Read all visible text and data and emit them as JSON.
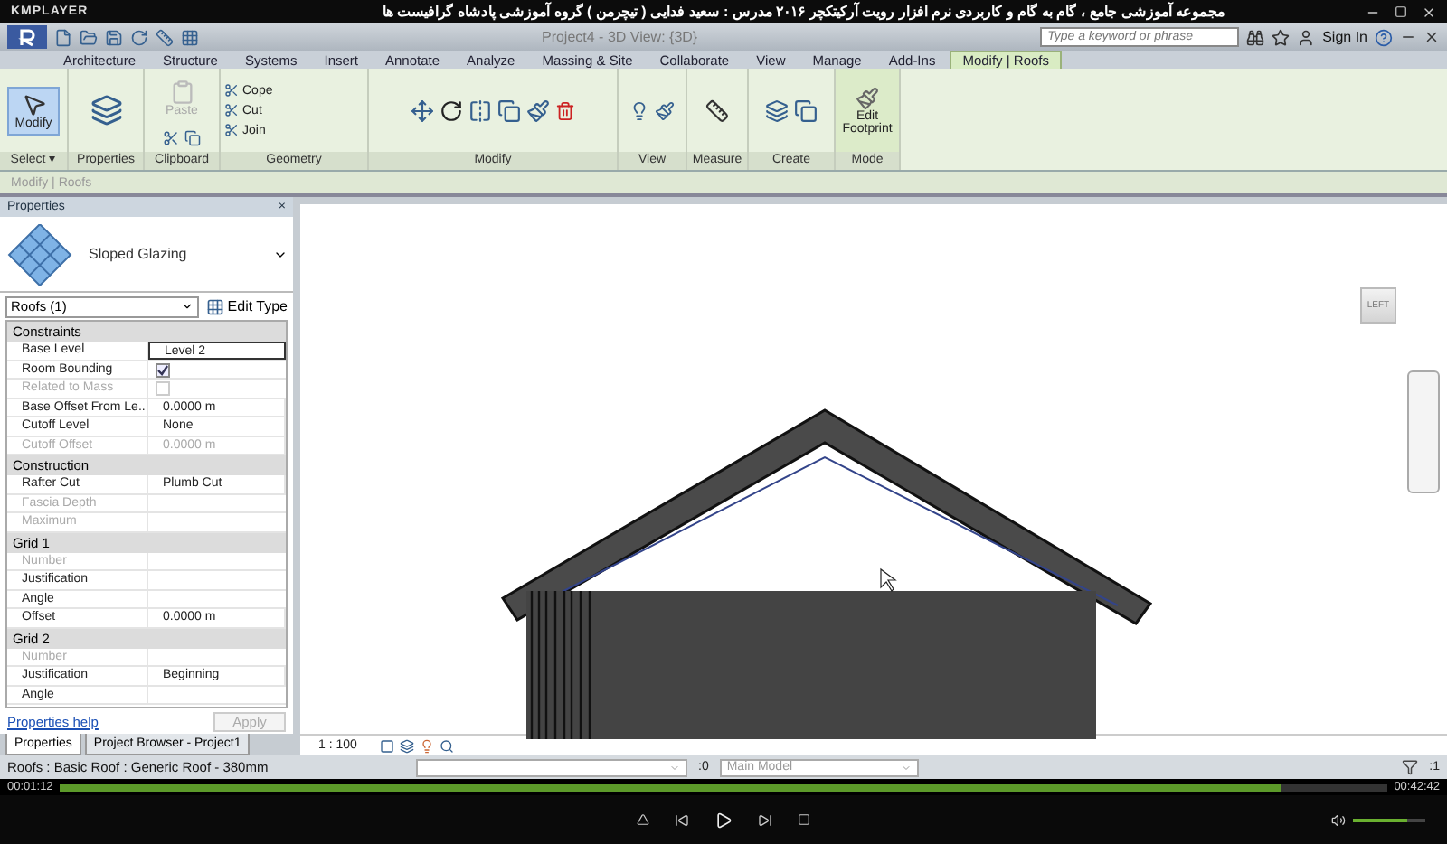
{
  "player": {
    "app_name": "KMPLAYER",
    "title": "مجموعه آموزشی جامع ، گام به گام و کاربردی نرم افزار رویت آرکیتکچر ۲۰۱۶  مدرس : سعید فدایی ( تیچرمن ) گروه آموزشی پادشاه گرافیست ها",
    "elapsed": "00:01:12",
    "total": "00:42:42",
    "level": 0.92,
    "volume": {
      "level": 0.75
    }
  },
  "app": {
    "view_title": "Project4 - 3D View: {3D}",
    "search": {
      "placeholder": "Type a keyword or phrase"
    },
    "sign_in": "Sign In"
  },
  "tabs": [
    {
      "label": "Architecture",
      "selected": false
    },
    {
      "label": "Structure",
      "selected": false
    },
    {
      "label": "Systems",
      "selected": false
    },
    {
      "label": "Insert",
      "selected": false
    },
    {
      "label": "Annotate",
      "selected": false
    },
    {
      "label": "Analyze",
      "selected": false
    },
    {
      "label": "Massing & Site",
      "selected": false
    },
    {
      "label": "Collaborate",
      "selected": false
    },
    {
      "label": "View",
      "selected": false
    },
    {
      "label": "Manage",
      "selected": false
    },
    {
      "label": "Add-Ins",
      "selected": false
    },
    {
      "label": "Modify | Roofs",
      "selected": true
    }
  ],
  "ribbon": {
    "modify": "Modify",
    "paste": "Paste",
    "geometry": [
      "Cope",
      "Cut",
      "Join"
    ],
    "edit_footprint": "Edit Footprint",
    "panels": [
      "Select ▾",
      "Properties",
      "Clipboard",
      "Geometry",
      "Modify",
      "View",
      "Measure",
      "Create",
      "Mode"
    ]
  },
  "context_bar": "Modify | Roofs",
  "properties": {
    "title": "Properties",
    "close": "×",
    "type_name": "Sloped Glazing",
    "selector": "Roofs (1)",
    "edit_type": "Edit Type",
    "groups": [
      {
        "name": "Constraints",
        "rows": [
          {
            "label": "Base Level",
            "kind": "text",
            "value": "Level 2",
            "disabled": false
          },
          {
            "label": "Room Bounding",
            "kind": "check",
            "checked": true,
            "disabled": false
          },
          {
            "label": "Related to Mass",
            "kind": "check",
            "checked": false,
            "disabled": true
          },
          {
            "label": "Base Offset From Le...",
            "kind": "text",
            "value": "0.0000 m",
            "disabled": false
          },
          {
            "label": "Cutoff Level",
            "kind": "text",
            "value": "None",
            "disabled": false
          },
          {
            "label": "Cutoff Offset",
            "kind": "text",
            "value": "0.0000 m",
            "disabled": true
          }
        ]
      },
      {
        "name": "Construction",
        "rows": [
          {
            "label": "Rafter Cut",
            "kind": "text",
            "value": "Plumb Cut",
            "disabled": false
          },
          {
            "label": "Fascia Depth",
            "kind": "text",
            "disabled": true
          },
          {
            "label": "Maximum",
            "kind": "text",
            "disabled": true
          }
        ]
      },
      {
        "name": "Grid 1",
        "rows": [
          {
            "label": "Number",
            "kind": "text",
            "disabled": true
          },
          {
            "label": "Justification",
            "kind": "text",
            "disabled": false
          },
          {
            "label": "Angle",
            "kind": "text",
            "disabled": false
          },
          {
            "label": "Offset",
            "kind": "text",
            "value": "0.0000 m",
            "disabled": false
          }
        ]
      },
      {
        "name": "Grid 2",
        "rows": [
          {
            "label": "Number",
            "kind": "text",
            "disabled": true
          },
          {
            "label": "Justification",
            "kind": "text",
            "value": "Beginning",
            "disabled": false
          },
          {
            "label": "Angle",
            "kind": "text",
            "disabled": false
          }
        ]
      }
    ],
    "help": "Properties help",
    "apply": "Apply",
    "tabs": [
      {
        "label": "Properties",
        "selected": true
      },
      {
        "label": "Project Browser - Project1",
        "selected": false
      }
    ]
  },
  "view": {
    "viewcube": "LEFT",
    "scale": "1 : 100"
  },
  "status": {
    "text": "Roofs : Basic Roof : Generic Roof - 380mm",
    "workset_count": ":0",
    "model": "Main Model",
    "filter_count": ":1"
  }
}
